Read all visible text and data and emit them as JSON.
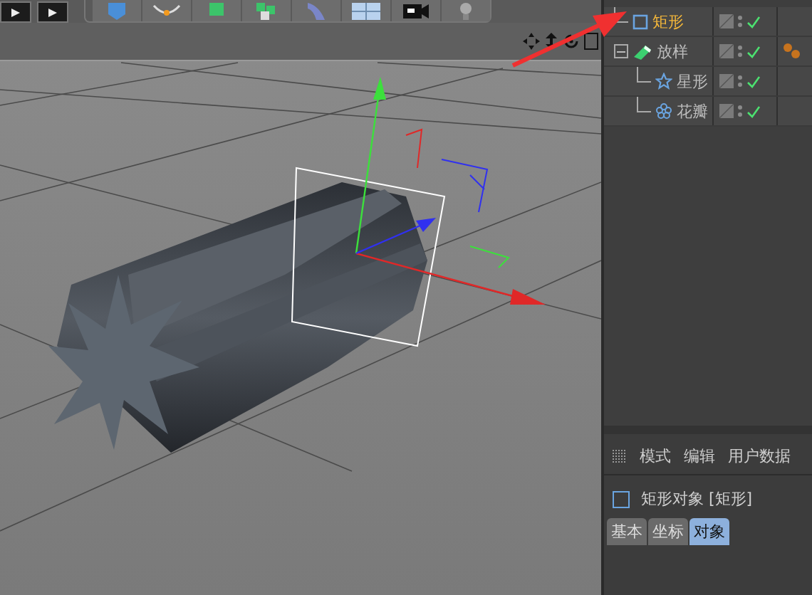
{
  "objects": [
    {
      "name": "矩形",
      "kind": "rectangle",
      "selected": true,
      "enabled": true,
      "material_tag": false
    },
    {
      "name": "放样",
      "kind": "loft",
      "selected": false,
      "enabled": true,
      "material_tag": true,
      "expanded": true,
      "children": [
        {
          "name": "星形",
          "kind": "star",
          "selected": false,
          "enabled": true,
          "material_tag": false
        },
        {
          "name": "花瓣",
          "kind": "flower",
          "selected": false,
          "enabled": true,
          "material_tag": false
        }
      ]
    }
  ],
  "attributes": {
    "menu": [
      "模式",
      "编辑",
      "用户数据"
    ],
    "title": "矩形对象 [矩形]",
    "tabs": [
      {
        "label": "基本",
        "selected": false
      },
      {
        "label": "坐标",
        "selected": false
      },
      {
        "label": "对象",
        "selected": true
      }
    ]
  }
}
